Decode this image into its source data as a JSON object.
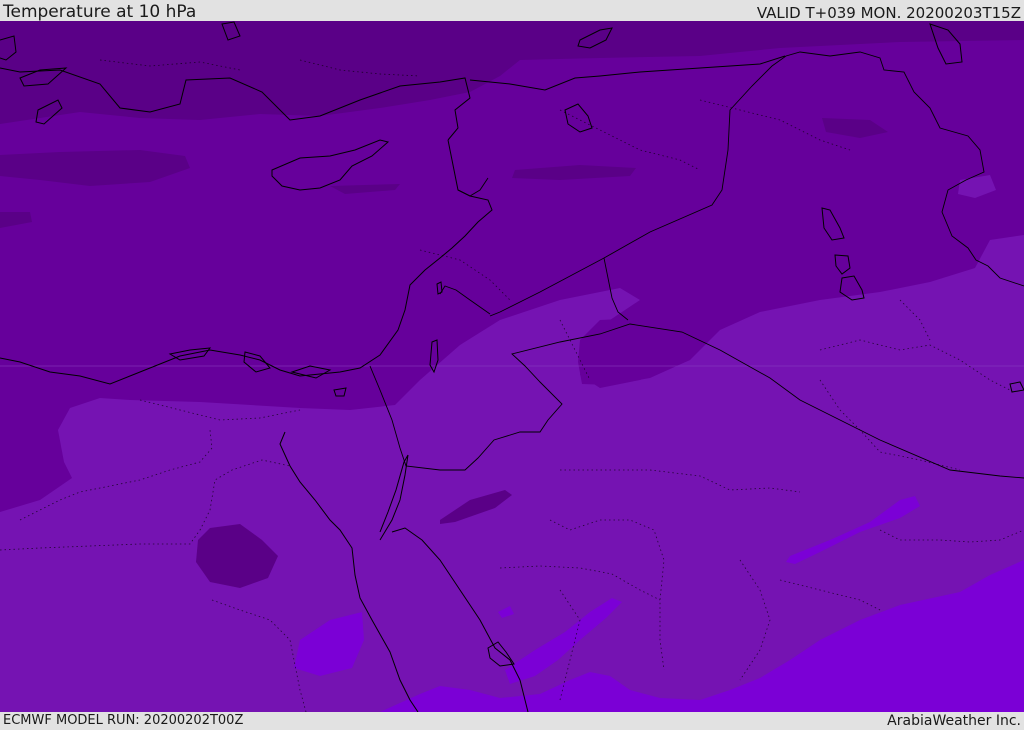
{
  "header": {
    "title": "Temperature at 10 hPa",
    "valid": "VALID T+039 MON. 20200203T15Z"
  },
  "footer": {
    "model_run": "ECMWF MODEL RUN: 20200202T00Z",
    "credit": "ArabiaWeather Inc."
  },
  "map": {
    "field": "Temperature at 10 hPa",
    "colors": {
      "darkest": "#5a0087",
      "dark": "#66009b",
      "mid": "#7513b2",
      "light": "#7b00d6",
      "border": "#000000"
    }
  }
}
